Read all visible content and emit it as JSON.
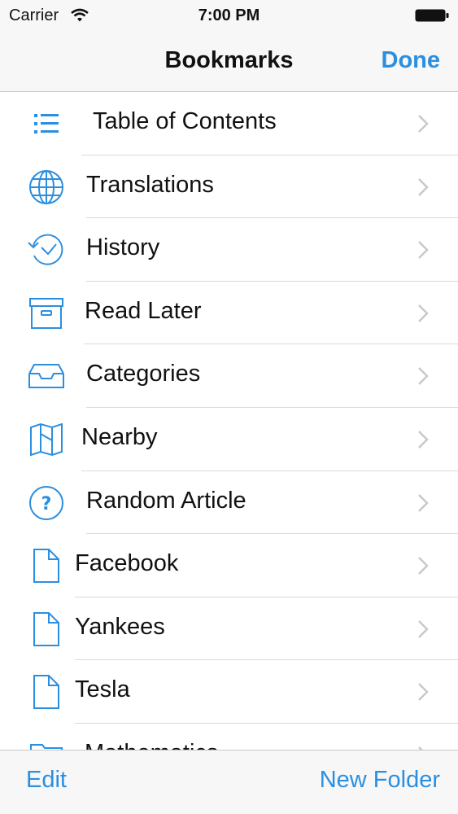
{
  "status_bar": {
    "carrier": "Carrier",
    "time": "7:00 PM"
  },
  "nav_bar": {
    "title": "Bookmarks",
    "done_label": "Done"
  },
  "items": [
    {
      "label": "Table of Contents",
      "icon": "list-icon"
    },
    {
      "label": "Translations",
      "icon": "globe-icon"
    },
    {
      "label": "History",
      "icon": "history-clock-icon"
    },
    {
      "label": "Read Later",
      "icon": "archive-box-icon"
    },
    {
      "label": "Categories",
      "icon": "inbox-tray-icon"
    },
    {
      "label": "Nearby",
      "icon": "map-icon"
    },
    {
      "label": "Random Article",
      "icon": "question-circle-icon"
    },
    {
      "label": "Facebook",
      "icon": "document-icon"
    },
    {
      "label": "Yankees",
      "icon": "document-icon"
    },
    {
      "label": "Tesla",
      "icon": "document-icon"
    },
    {
      "label": "Mathematics",
      "icon": "folder-icon"
    }
  ],
  "toolbar": {
    "edit_label": "Edit",
    "new_folder_label": "New Folder"
  },
  "colors": {
    "accent": "#2b8fe0",
    "bar_background": "#f7f7f7",
    "separator": "#d9d9de",
    "chevron": "#c7c7cc"
  }
}
